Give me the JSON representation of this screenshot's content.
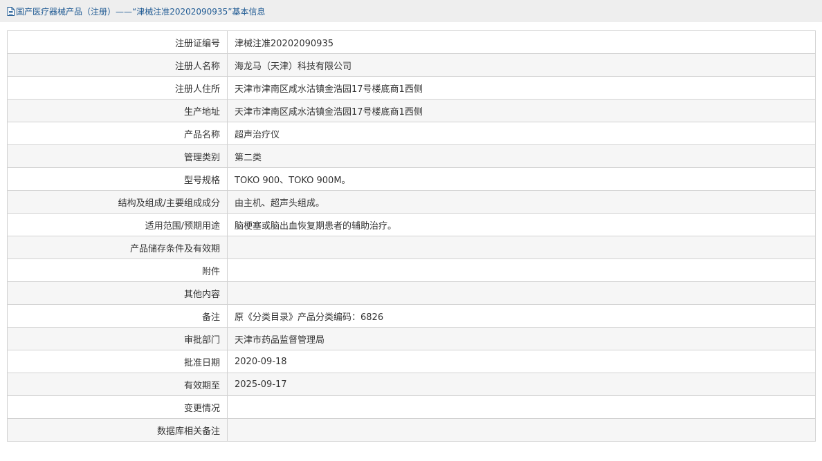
{
  "breadcrumb": {
    "icon": "document-icon",
    "text": "国产医疗器械产品（注册）——“津械注准20202090935”基本信息"
  },
  "rows": [
    {
      "label": "注册证编号",
      "value": "津械注准20202090935"
    },
    {
      "label": "注册人名称",
      "value": "海龙马（天津）科技有限公司"
    },
    {
      "label": "注册人住所",
      "value": "天津市津南区咸水沽镇金浩园17号楼底商1西侧"
    },
    {
      "label": "生产地址",
      "value": "天津市津南区咸水沽镇金浩园17号楼底商1西侧"
    },
    {
      "label": "产品名称",
      "value": "超声治疗仪"
    },
    {
      "label": "管理类别",
      "value": "第二类"
    },
    {
      "label": "型号规格",
      "value": "TOKO 900、TOKO 900M。"
    },
    {
      "label": "结构及组成/主要组成成分",
      "value": "由主机、超声头组成。"
    },
    {
      "label": "适用范围/预期用途",
      "value": "脑梗塞或脑出血恢复期患者的辅助治疗。"
    },
    {
      "label": "产品储存条件及有效期",
      "value": ""
    },
    {
      "label": "附件",
      "value": ""
    },
    {
      "label": "其他内容",
      "value": ""
    },
    {
      "label": "备注",
      "value": "原《分类目录》产品分类编码：6826"
    },
    {
      "label": "审批部门",
      "value": "天津市药品监督管理局"
    },
    {
      "label": "批准日期",
      "value": "2020-09-18"
    },
    {
      "label": "有效期至",
      "value": "2025-09-17"
    },
    {
      "label": "变更情况",
      "value": ""
    },
    {
      "label": "数据库相关备注",
      "value": ""
    }
  ]
}
